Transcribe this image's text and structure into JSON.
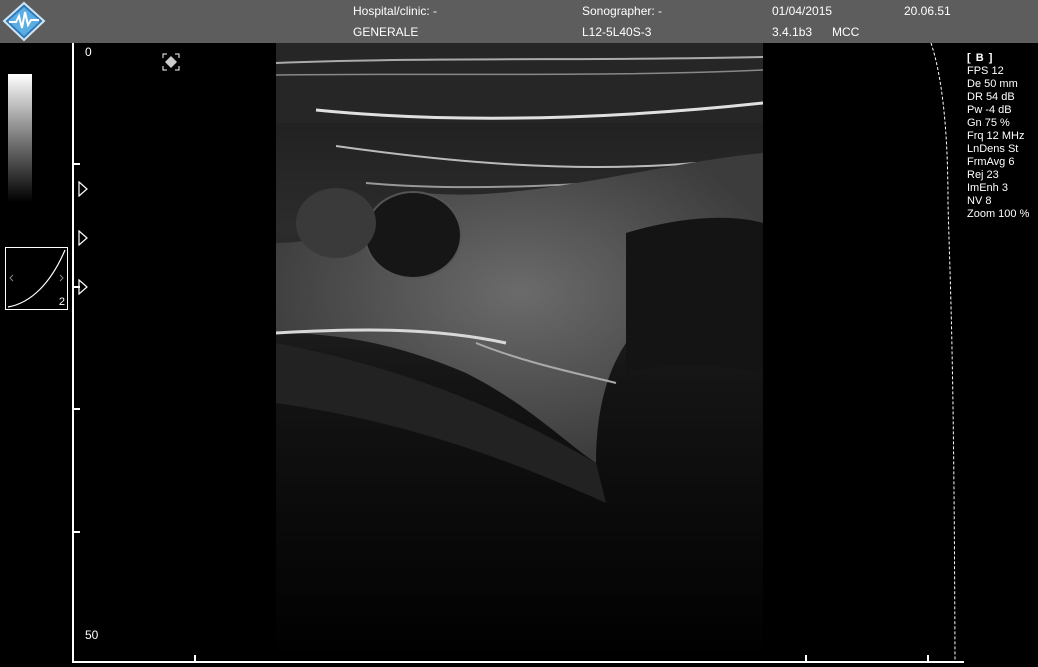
{
  "header": {
    "hospital_label": "Hospital/clinic: -",
    "department": "GENERALE",
    "sonographer_label": "Sonographer: -",
    "probe": "L12-5L40S-3",
    "date": "01/04/2015",
    "version": "3.4.1b3",
    "mode_code": "MCC",
    "time": "20.06.51"
  },
  "depth": {
    "top": "0",
    "bottom": "50"
  },
  "tgc": {
    "curve_id": "2"
  },
  "params": {
    "mode": "[ B ]",
    "items": [
      "FPS 12",
      "De 50 mm",
      "DR 54 dB",
      "Pw -4 dB",
      "Gn 75 %",
      "Frq 12 MHz",
      "LnDens St",
      "FrmAvg 6",
      "Rej 23",
      "ImEnh 3",
      "NV 8",
      "Zoom 100 %"
    ]
  },
  "colors": {
    "header_bg": "#5d5d5d",
    "background": "#000000",
    "text": "#ffffff",
    "logo_blue": "#4a9fd6"
  },
  "icons": {
    "logo": "app-logo-icon",
    "roi": "roi-handle-icon",
    "focus": "focus-marker-icon"
  }
}
